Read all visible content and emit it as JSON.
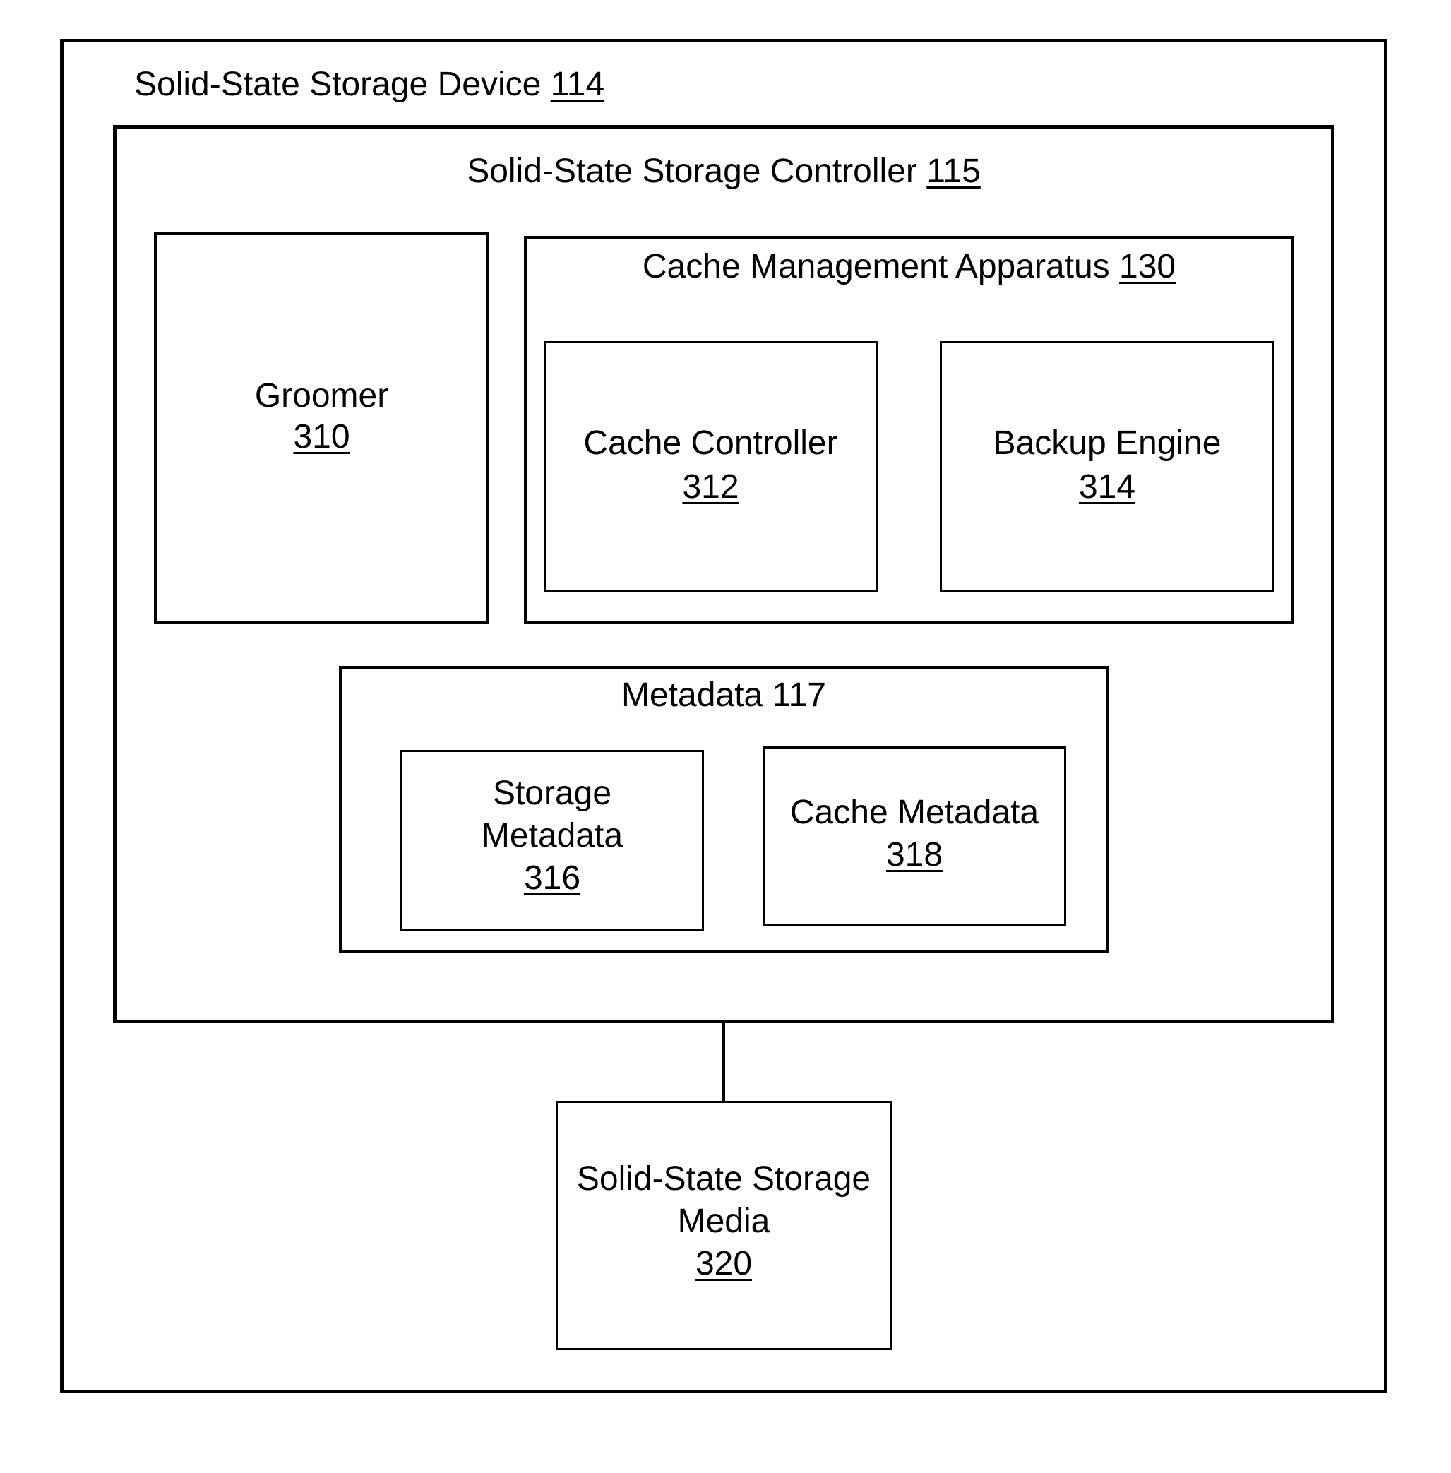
{
  "diagram": {
    "device": {
      "title": "Solid-State Storage Device",
      "ref": "114"
    },
    "controller": {
      "title": "Solid-State Storage Controller",
      "ref": "115"
    },
    "groomer": {
      "title": "Groomer",
      "ref": "310"
    },
    "cache_management": {
      "title": "Cache Management Apparatus",
      "ref": "130",
      "cache_controller": {
        "title": "Cache Controller",
        "ref": "312"
      },
      "backup_engine": {
        "title": "Backup Engine",
        "ref": "314"
      }
    },
    "metadata": {
      "title": "Metadata 117",
      "storage_metadata": {
        "title_line1": "Storage",
        "title_line2": "Metadata",
        "ref": "316"
      },
      "cache_metadata": {
        "title": "Cache Metadata",
        "ref": "318"
      }
    },
    "media": {
      "title_line1": "Solid-State Storage",
      "title_line2": "Media",
      "ref": "320"
    },
    "connections": [
      {
        "from": "Solid-State Storage Controller 115",
        "to": "Solid-State Storage Media 320"
      }
    ]
  }
}
